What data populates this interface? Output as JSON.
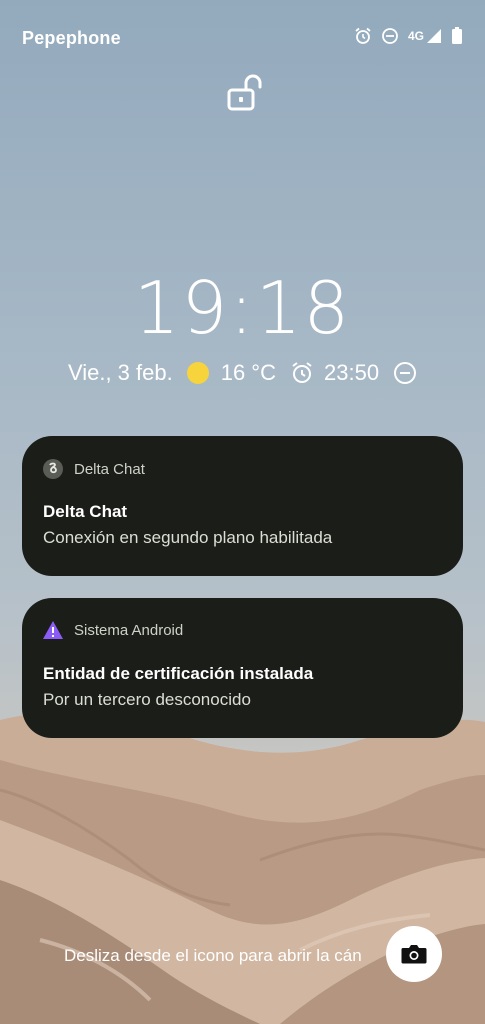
{
  "status_bar": {
    "carrier": "Pepephone",
    "network": "4G",
    "icons": [
      "alarm-icon",
      "do-not-disturb-icon",
      "signal-icon",
      "battery-icon"
    ]
  },
  "lock": {
    "icon": "unlocked-padlock-icon"
  },
  "clock": {
    "time": "19:18"
  },
  "date_row": {
    "date": "Vie., 3 feb.",
    "weather_icon": "sun-icon",
    "temperature": "16 °C",
    "alarm_icon": "alarm-icon",
    "alarm_time": "23:50",
    "dnd_icon": "do-not-disturb-icon"
  },
  "notifications": [
    {
      "app_icon": "delta-chat-icon",
      "app_name": "Delta Chat",
      "title": "Delta Chat",
      "body": "Conexión en segundo plano habilitada"
    },
    {
      "app_icon": "warning-icon",
      "app_name": "Sistema Android",
      "title": "Entidad de certificación instalada",
      "body": "Por un tercero desconocido"
    }
  ],
  "bottom": {
    "hint": "Desliza desde el icono para abrir la cán",
    "camera_icon": "camera-icon"
  },
  "colors": {
    "card_bg": "#1b1d18",
    "sun": "#f7d43c",
    "warning": "#8b5cf6"
  }
}
